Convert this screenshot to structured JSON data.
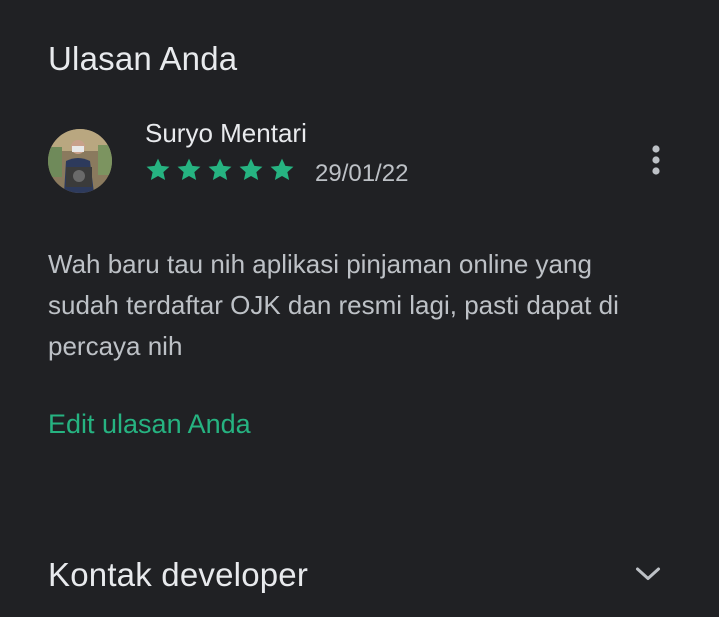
{
  "review_section": {
    "title": "Ulasan Anda",
    "reviewer_name": "Suryo Mentari",
    "rating": 5,
    "rating_max": 5,
    "date": "29/01/22",
    "text": "Wah baru tau nih aplikasi pinjaman online yang sudah terdaftar OJK dan resmi lagi, pasti dapat di percaya nih",
    "edit_label": "Edit ulasan Anda"
  },
  "developer_section": {
    "title": "Kontak developer"
  },
  "icons": {
    "star": "star-icon",
    "more": "more-vert-icon",
    "expand": "chevron-down-icon"
  },
  "colors": {
    "background": "#202124",
    "accent": "#26b381",
    "primary_text": "#e8eaed",
    "secondary_text": "#bdc1c6"
  }
}
